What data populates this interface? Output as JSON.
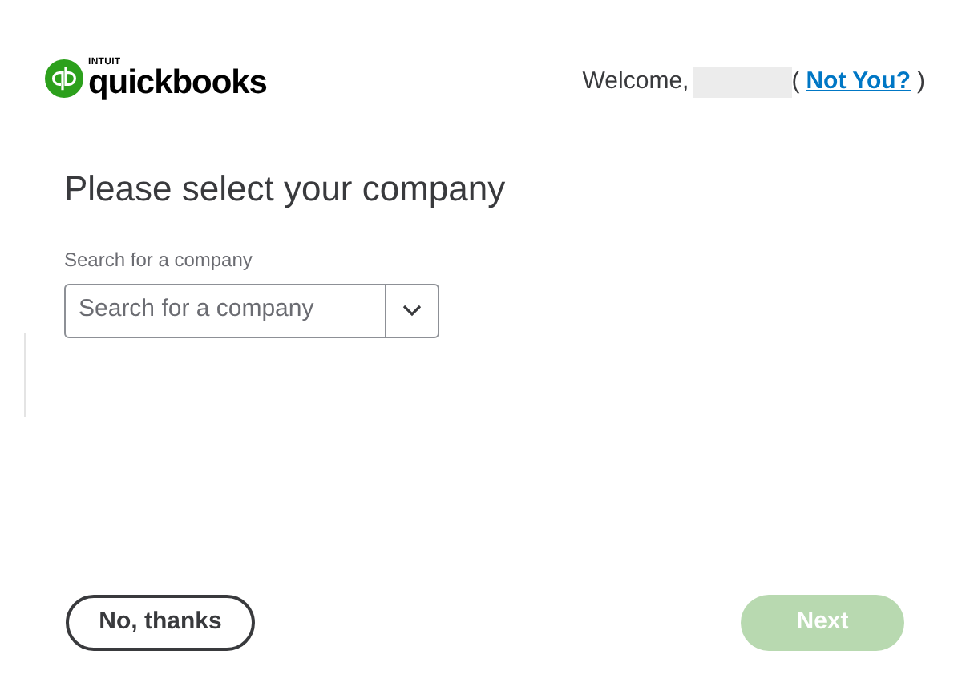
{
  "header": {
    "logo": {
      "brand": "INTUIT",
      "product": "quickbooks"
    },
    "welcome": "Welcome,",
    "user_redacted": true,
    "open_paren": "(",
    "not_you_link": "Not You?",
    "close_paren": ")"
  },
  "title": "Please select your company",
  "company_search": {
    "label": "Search for a company",
    "placeholder": "Search for a company"
  },
  "buttons": [
    {
      "label": "No, thanks",
      "kind": "secondary",
      "disabled": false
    },
    {
      "label": "Next",
      "kind": "primary",
      "disabled": true
    }
  ]
}
